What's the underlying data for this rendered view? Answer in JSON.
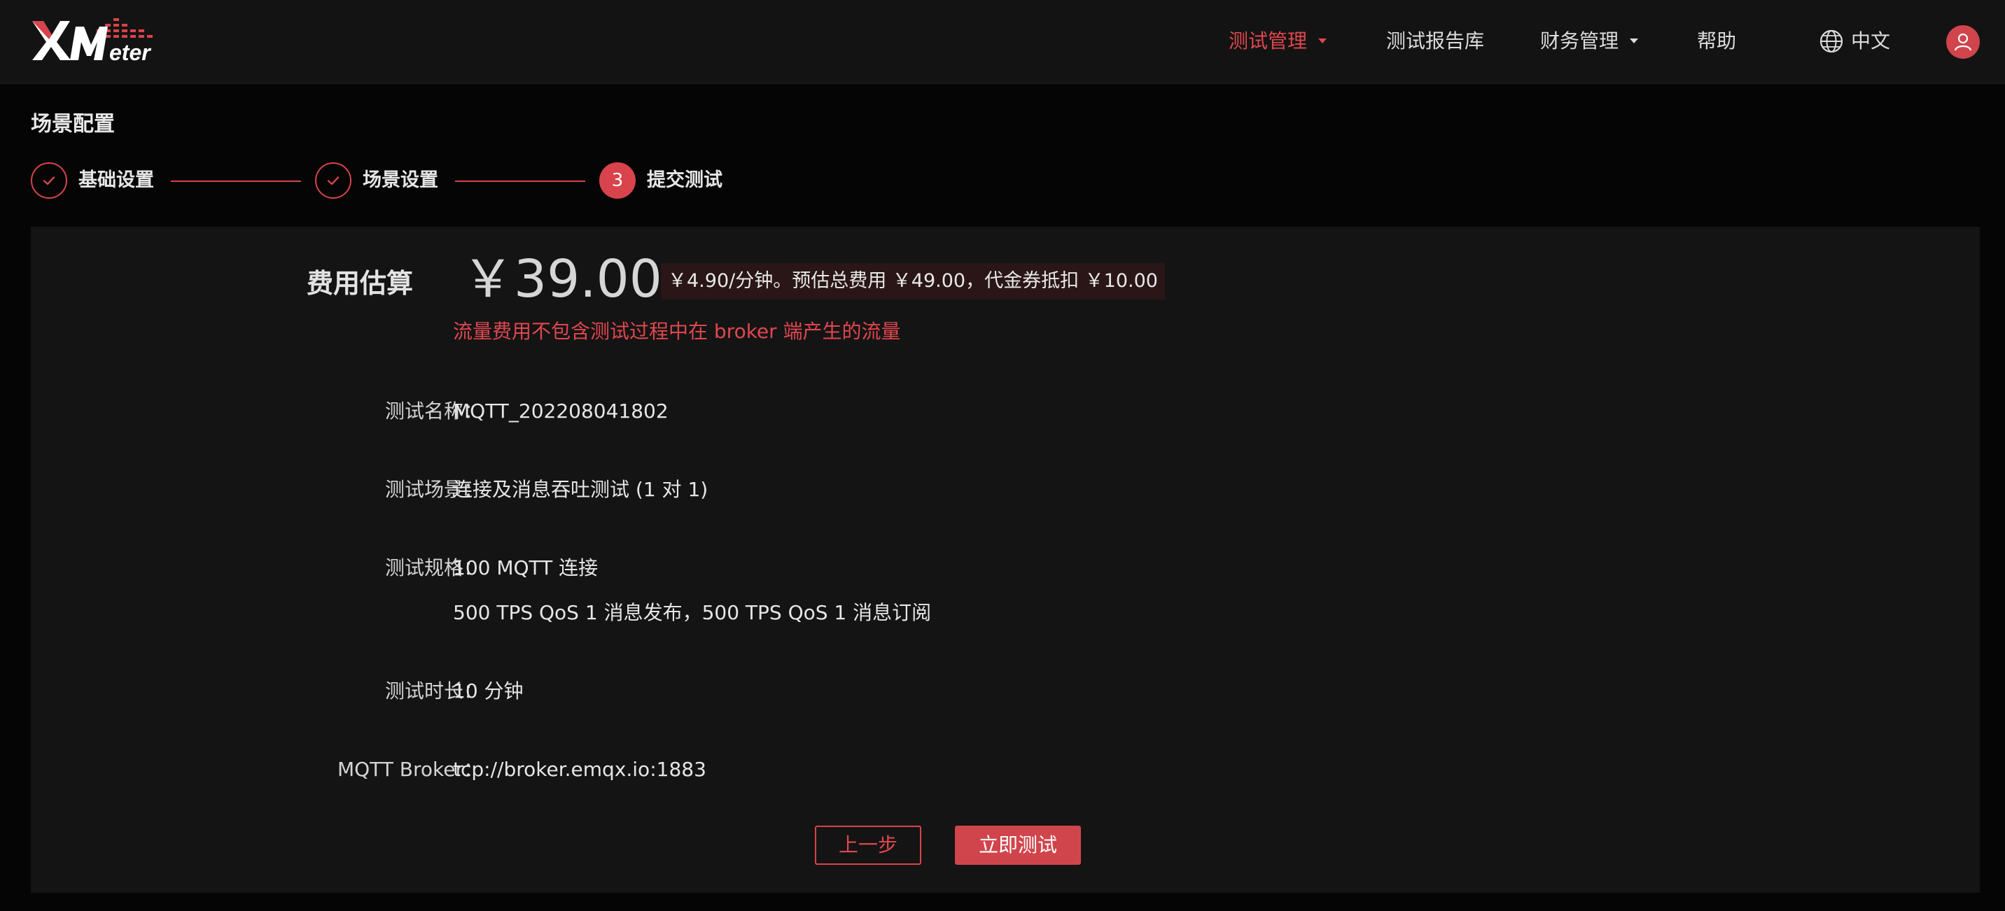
{
  "app": {
    "logo_text": "XMeter"
  },
  "nav": {
    "items": [
      {
        "label": "测试管理",
        "active": true,
        "has_dropdown": true
      },
      {
        "label": "测试报告库",
        "active": false,
        "has_dropdown": false
      },
      {
        "label": "财务管理",
        "active": false,
        "has_dropdown": true
      },
      {
        "label": "帮助",
        "active": false,
        "has_dropdown": false
      }
    ],
    "language": {
      "label": "中文",
      "icon": "globe-icon"
    },
    "avatar_icon": "user-icon"
  },
  "page": {
    "title": "场景配置"
  },
  "steps": [
    {
      "label": "基础设置",
      "status": "done",
      "icon": "check-icon"
    },
    {
      "label": "场景设置",
      "status": "done",
      "icon": "check-icon"
    },
    {
      "label": "提交测试",
      "status": "current",
      "number": "3"
    }
  ],
  "fee": {
    "label": "费用估算",
    "amount": "￥39.00",
    "detail": "￥4.90/分钟。预估总费用 ￥49.00，代金券抵扣 ￥10.00",
    "note": "流量费用不包含测试过程中在 broker 端产生的流量"
  },
  "details": [
    {
      "label": "测试名称：",
      "values": [
        "MQTT_202208041802"
      ]
    },
    {
      "label": "测试场景：",
      "values": [
        "连接及消息吞吐测试 (1 对 1)"
      ]
    },
    {
      "label": "测试规格：",
      "values": [
        "100 MQTT 连接",
        "500 TPS QoS 1 消息发布，500 TPS QoS 1 消息订阅"
      ]
    },
    {
      "label": "测试时长：",
      "values": [
        "10 分钟"
      ]
    },
    {
      "label": "MQTT Broker：",
      "values": [
        "tcp://broker.emqx.io:1883"
      ]
    }
  ],
  "actions": {
    "prev_label": "上一步",
    "submit_label": "立即测试"
  },
  "colors": {
    "accent": "#d9434b",
    "header_bg": "#131313",
    "panel_bg": "#141414",
    "page_bg": "#050505"
  }
}
